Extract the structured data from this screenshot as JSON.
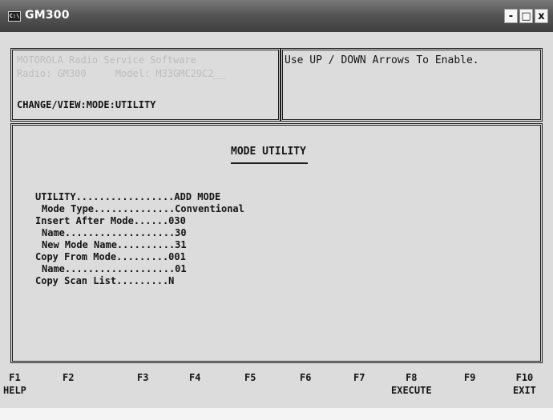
{
  "window": {
    "title": "GM300",
    "icon_label": "C:\\",
    "controls": {
      "minimize": "-",
      "maximize": "□",
      "close": "x"
    }
  },
  "info_panel": {
    "faint_line1": "MOTOROLA Radio Service Software",
    "faint_line2": "Radio: GM300     Model: M33GMC29C2__",
    "path": "CHANGE/VIEW:MODE:UTILITY"
  },
  "hint_panel": {
    "text": "Use UP / DOWN Arrows To Enable."
  },
  "main_panel": {
    "title": "MODE UTILITY",
    "fields": [
      {
        "label": "UTILITY.................",
        "value": "ADD MODE"
      },
      {
        "label": "Mode Type..............",
        "value": "Conventional"
      },
      {
        "label": "Insert After Mode......",
        "value": "030"
      },
      {
        "label": "Name...................",
        "value": "30"
      },
      {
        "label": "New Mode Name..........",
        "value": "31"
      },
      {
        "label": "Copy From Mode.........",
        "value": "001"
      },
      {
        "label": "Name...................",
        "value": "01"
      },
      {
        "label": "Copy Scan List.........",
        "value": "N"
      }
    ]
  },
  "function_keys": [
    {
      "key": "F1",
      "label": "HELP"
    },
    {
      "key": "F2",
      "label": ""
    },
    {
      "key": "F3",
      "label": ""
    },
    {
      "key": "F4",
      "label": ""
    },
    {
      "key": "F5",
      "label": ""
    },
    {
      "key": "F6",
      "label": ""
    },
    {
      "key": "F7",
      "label": ""
    },
    {
      "key": "F8",
      "label": "EXECUTE"
    },
    {
      "key": "F9",
      "label": ""
    },
    {
      "key": "F10",
      "label": "EXIT"
    }
  ]
}
